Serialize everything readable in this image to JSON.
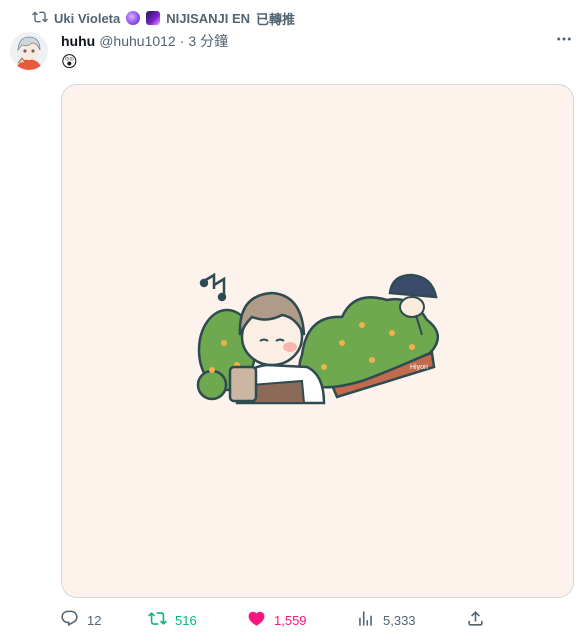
{
  "retweet": {
    "retweeter_name": "Uki Violeta",
    "affiliation": "NIJISANJI EN",
    "retweeted_label": "已轉推",
    "icon": "retweet-icon"
  },
  "tweet": {
    "author_name": "huhu",
    "handle": "@huhu1012",
    "separator": "·",
    "time": "3 分鐘",
    "text": "😲",
    "media_caption_art": "Hiyori",
    "more_icon": "more-icon"
  },
  "actions": {
    "reply_count": "12",
    "retweet_count": "516",
    "like_count": "1,559",
    "views_count": "5,333"
  },
  "colors": {
    "retweet_green": "#00ba7c",
    "like_pink": "#f91880",
    "muted_gray": "#536471",
    "media_background": "#fdf2ec"
  }
}
